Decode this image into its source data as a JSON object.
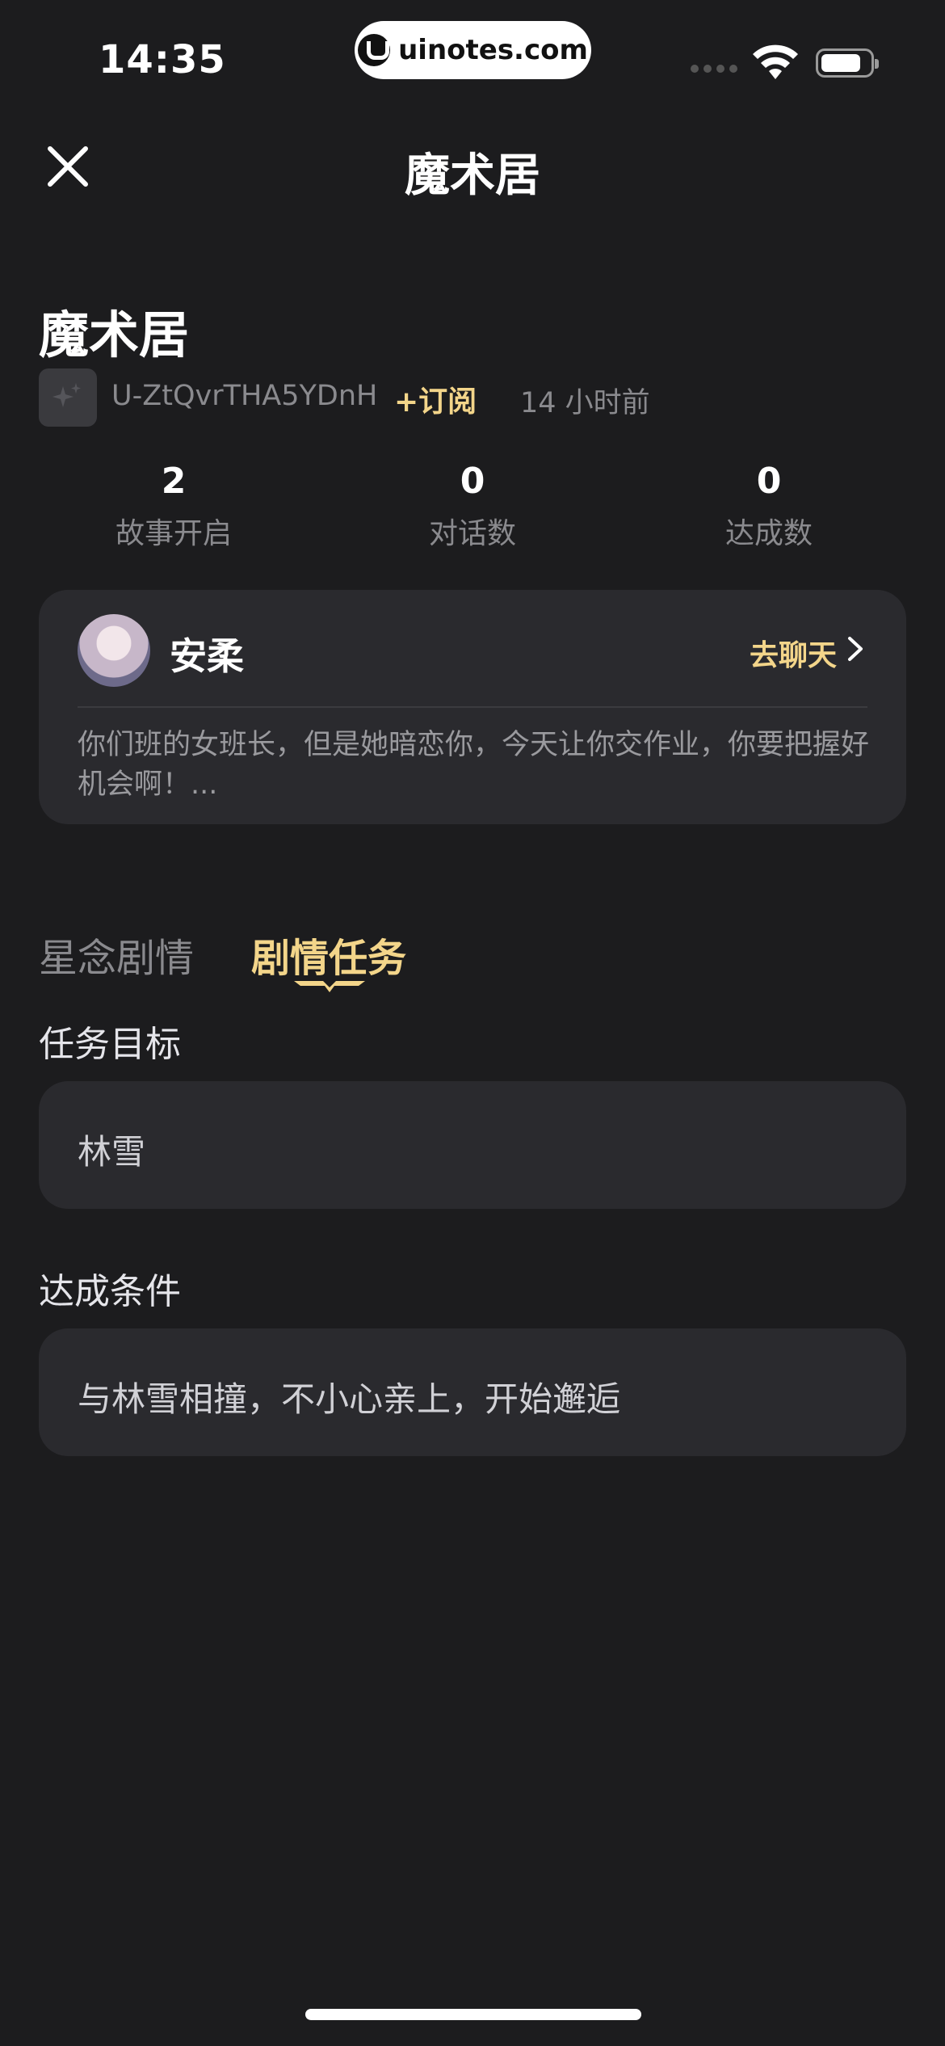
{
  "status_bar": {
    "time": "14:35",
    "watermark": "uinotes.com"
  },
  "nav": {
    "title": "魔术居"
  },
  "story": {
    "title": "魔术居",
    "author": "U-ZtQvrTHA5YDnH",
    "subscribe_label": "+订阅",
    "time_ago": "14 小时前"
  },
  "stats": [
    {
      "value": "2",
      "label": "故事开启"
    },
    {
      "value": "0",
      "label": "对话数"
    },
    {
      "value": "0",
      "label": "达成数"
    }
  ],
  "character": {
    "name": "安柔",
    "chat_label": "去聊天",
    "description": "你们班的女班长，但是她暗恋你，今天让你交作业，你要把握好机会啊！..."
  },
  "tabs": [
    {
      "label": "星念剧情",
      "active": false
    },
    {
      "label": "剧情任务",
      "active": true
    }
  ],
  "task": {
    "goal_label": "任务目标",
    "goal_value": "林雪",
    "condition_label": "达成条件",
    "condition_value": "与林雪相撞，不小心亲上，开始邂逅"
  },
  "colors": {
    "accent": "#f3d58a",
    "background": "#1c1c1e",
    "card": "#2a2a2e"
  }
}
